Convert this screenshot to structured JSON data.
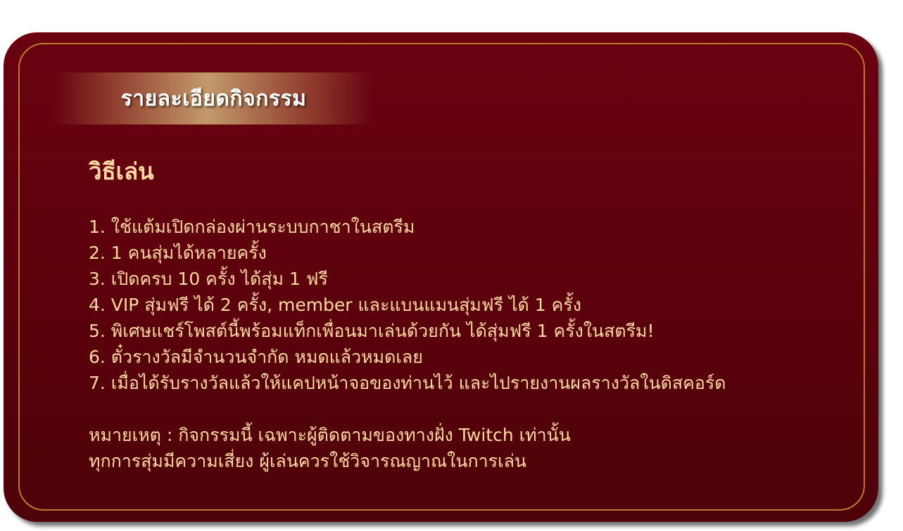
{
  "title": "รายละเอียดกิจกรรม",
  "heading": "วิธีเล่น",
  "rules": [
    "1. ใช้แต้มเปิดกล่องผ่านระบบกาชาในสตรีม",
    "2. 1 คนสุ่มได้หลายครั้ง",
    "3. เปิดครบ 10 ครั้ง ได้สุ่ม 1 ฟรี",
    "4. VIP สุ่มฟรี ได้ 2 ครั้ง, member และแบนแมนสุ่มฟรี ได้ 1 ครั้ง",
    "5. พิเศษแชร์โพสต์นี้พร้อมแท็กเพื่อนมาเล่นด้วยกัน ได้สุ่มฟรี 1 ครั้งในสตรีม!",
    "6. ตั๋วรางวัลมีจำนวนจำกัด หมดแล้วหมดเลย",
    "7. เมื่อได้รับรางวัลแล้วให้แคปหน้าจอของท่านไว้ และไปรายงานผลรางวัลในดิสคอร์ด"
  ],
  "notes": [
    "หมายเหตุ : กิจกรรมนี้ เฉพาะผู้ติดตามของทางฝั่ง Twitch เท่านั้น",
    "ทุกการสุ่มมีความเสี่ยง ผู้เล่นควรใช้วิจารณญาณในการเล่น"
  ],
  "colors": {
    "card_background": "#620210",
    "frame_border": "#b87a2e",
    "text_gold": "#ffd9a1",
    "title_text": "#ffffff"
  }
}
